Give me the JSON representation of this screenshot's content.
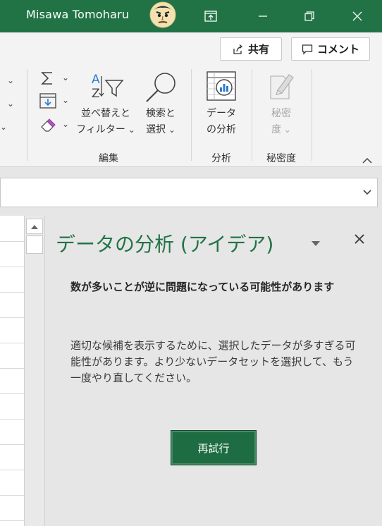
{
  "titlebar": {
    "user_name": "Misawa Tomoharu",
    "accent": "#217346"
  },
  "ribbon": {
    "share_label": "共有",
    "comment_label": "コメント",
    "sort_filter_line1": "並べ替えと",
    "sort_filter_line2": "フィルター",
    "find_select_line1": "検索と",
    "find_select_line2": "選択",
    "analyze_line1": "データ",
    "analyze_line2": "の分析",
    "sensitivity_line1": "秘密",
    "sensitivity_line2": "度",
    "group_editing": "編集",
    "group_analysis": "分析",
    "group_sensitivity": "秘密度"
  },
  "pane": {
    "title": "データの分析 (アイデア)",
    "heading": "数が多いことが逆に問題になっている可能性があります",
    "message": "適切な候補を表示するために、選択したデータが多すぎる可能性があります。より少ないデータセットを選択して、もう一度やり直してください。",
    "retry_label": "再試行"
  }
}
